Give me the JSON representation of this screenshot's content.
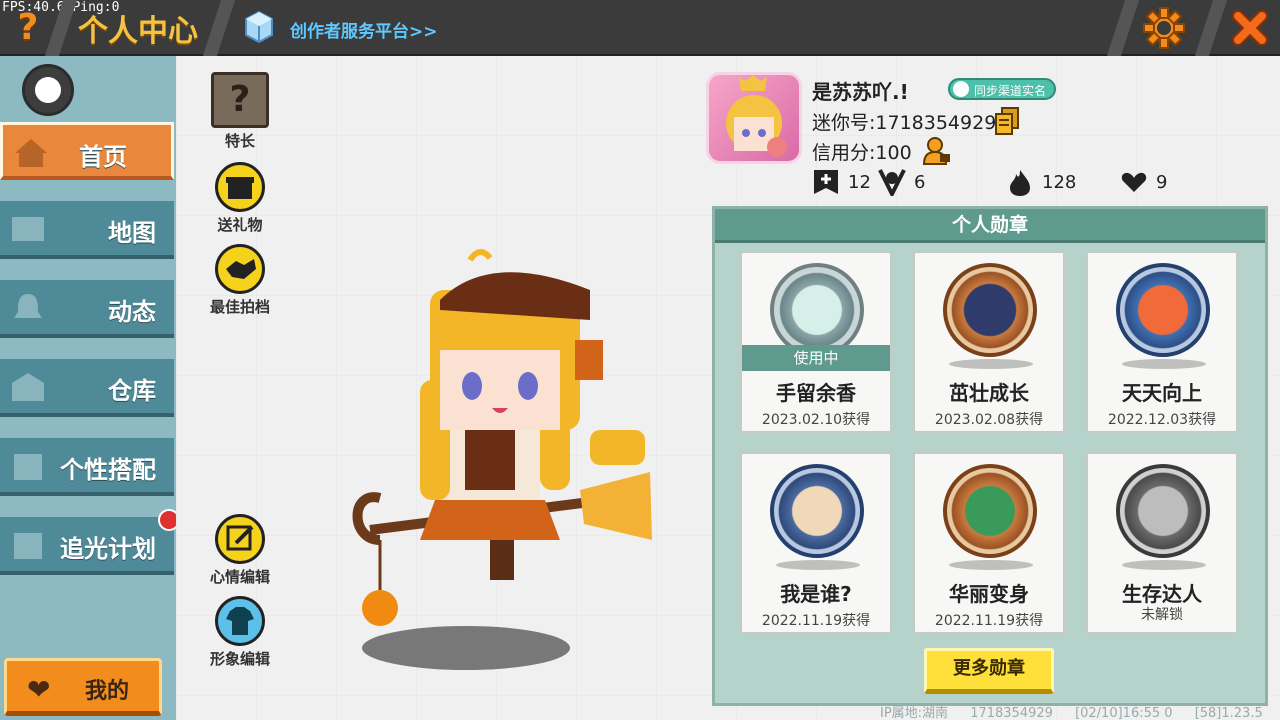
{
  "topbar": {
    "fps": "FPS:40.6",
    "ping": "Ping:0",
    "help_glyph": "?",
    "title": "个人中心",
    "creator_link": "创作者服务平台>>",
    "settings_icon": "gear-icon",
    "close_glyph": "✕"
  },
  "sidebar": {
    "items": [
      {
        "label": "首页",
        "icon": "home-icon",
        "active": true
      },
      {
        "label": "地图",
        "icon": "map-icon",
        "active": false
      },
      {
        "label": "动态",
        "icon": "bell-icon",
        "active": false
      },
      {
        "label": "仓库",
        "icon": "warehouse-icon",
        "active": false
      },
      {
        "label": "个性搭配",
        "icon": "outfit-icon",
        "active": false
      },
      {
        "label": "追光计划",
        "icon": "light-plan-icon",
        "active": false
      }
    ],
    "mine_label": "我的"
  },
  "actions": {
    "specialty": "特长",
    "send_gift": "送礼物",
    "best_shot": "最佳拍档",
    "mood_edit": "心情编辑",
    "image_edit": "形象编辑"
  },
  "profile": {
    "name": "是苏苏吖.!",
    "sync_label": "同步渠道实名",
    "mini_id": "迷你号:1718354929",
    "credit": "信用分:100",
    "stats": [
      {
        "icon": "plus-flag-icon",
        "value": "12"
      },
      {
        "icon": "fans-icon",
        "value": "6"
      },
      {
        "icon": "fire-icon",
        "value": "128"
      },
      {
        "icon": "hearts-icon",
        "value": "9"
      }
    ]
  },
  "badges": {
    "title": "个人勋章",
    "in_use_label": "使用中",
    "items": [
      {
        "name": "手留余香",
        "date": "2023.02.10获得",
        "in_use": true,
        "color": "#8aa5a8"
      },
      {
        "name": "茁壮成长",
        "date": "2023.02.08获得",
        "in_use": false,
        "color": "#c87a3e"
      },
      {
        "name": "天天向上",
        "date": "2022.12.03获得",
        "in_use": false,
        "color": "#3f6fb0"
      },
      {
        "name": "我是谁?",
        "date": "2022.11.19获得",
        "in_use": false,
        "color": "#4b6aa0"
      },
      {
        "name": "华丽变身",
        "date": "2022.11.19获得",
        "in_use": false,
        "color": "#c87a3e"
      },
      {
        "name": "生存达人",
        "date": "未解锁",
        "in_use": false,
        "color": "#8a8a8a"
      }
    ],
    "more_label": "更多勋章"
  },
  "footer": {
    "ip": "IP属地:湖南",
    "uid": "1718354929",
    "time": "[02/10]16:55 0",
    "version": "[58]1.23.5"
  },
  "colors": {
    "accent_orange": "#f28c1c",
    "sidebar_teal": "#4f8a99",
    "panel_green": "#5e9a8d",
    "title_gold": "#f5c342"
  }
}
